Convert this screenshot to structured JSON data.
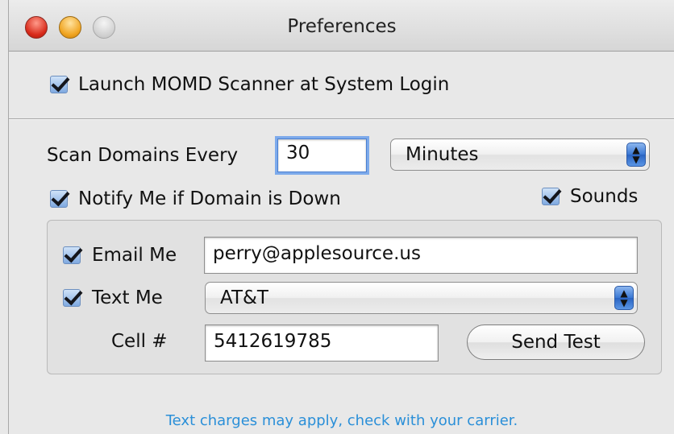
{
  "window": {
    "title": "Preferences"
  },
  "launch_at_login": {
    "label": "Launch MOMD Scanner at System Login",
    "checked": true
  },
  "scan": {
    "label": "Scan Domains Every",
    "interval_value": "30",
    "unit_selected": "Minutes"
  },
  "notify": {
    "label": "Notify Me if Domain is Down",
    "checked": true
  },
  "sounds": {
    "label": "Sounds",
    "checked": true
  },
  "email": {
    "label": "Email Me",
    "checked": true,
    "value": "perry@applesource.us"
  },
  "text": {
    "label": "Text Me",
    "checked": true,
    "carrier_selected": "AT&T"
  },
  "cell": {
    "label": "Cell #",
    "value": "5412619785"
  },
  "send_test": {
    "label": "Send Test"
  },
  "footer_note": "Text charges may apply, check with your carrier.",
  "colors": {
    "accent": "#3a78d4",
    "note": "#2a8fd8"
  }
}
